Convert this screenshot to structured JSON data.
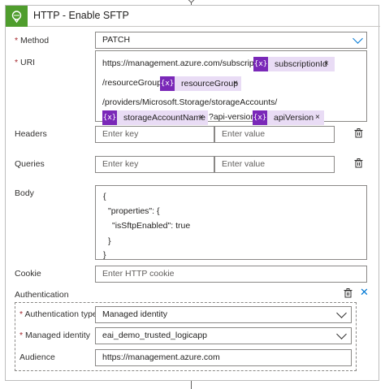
{
  "header": {
    "title": "HTTP - Enable SFTP",
    "icon": "globe-icon",
    "accent": "#4f9d2d"
  },
  "method": {
    "label": "Method",
    "value": "PATCH"
  },
  "uri": {
    "label": "URI",
    "line1_text": "https://management.azure.com/subscriptions/",
    "token_subscription": "subscriptionId",
    "line2_text": "/resourceGroups/",
    "token_resource_group": "resourceGroup",
    "line3_text": "/providers/Microsoft.Storage/storageAccounts/",
    "token_storage_account": "storageAccountName",
    "line4_mid": "?api-version=",
    "token_api_version": "apiVersion",
    "token_symbol": "{x}",
    "token_color": "#7a28b8"
  },
  "headers": {
    "label": "Headers",
    "key_placeholder": "Enter key",
    "value_placeholder": "Enter value"
  },
  "queries": {
    "label": "Queries",
    "key_placeholder": "Enter key",
    "value_placeholder": "Enter value"
  },
  "body": {
    "label": "Body",
    "lines": [
      "{",
      "\"properties\": {",
      "\"isSftpEnabled\": true",
      "}",
      "}"
    ]
  },
  "cookie": {
    "label": "Cookie",
    "placeholder": "Enter HTTP cookie"
  },
  "authentication": {
    "label": "Authentication",
    "type_label": "Authentication type",
    "type_value": "Managed identity",
    "identity_label": "Managed identity",
    "identity_value": "eai_demo_trusted_logicapp",
    "audience_label": "Audience",
    "audience_value": "https://management.azure.com"
  },
  "required_marker": "*",
  "close_symbol": "✕",
  "remove_symbol": "×"
}
